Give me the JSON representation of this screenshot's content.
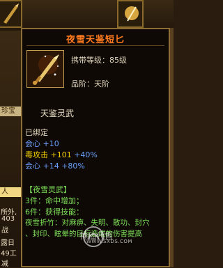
{
  "background": {
    "tab_label": "珍宝",
    "person_label": "人",
    "left_fragments": [
      "所外,",
      "403",
      "战",
      "露日",
      "49工",
      "减"
    ]
  },
  "tooltip": {
    "title": "夜雪天鉴短匕",
    "level_label": "携带等级：",
    "level_value": "85级",
    "grade_label": "品阶：",
    "grade_value": "天阶",
    "sub_title": "天鉴灵武",
    "bound": "已绑定",
    "stats": [
      {
        "name": "会心",
        "base": "+10",
        "bonus": "",
        "name_color": "blue"
      },
      {
        "name": "毒攻击",
        "base": "+101",
        "bonus": "+40%",
        "name_color": "yellow"
      },
      {
        "name": "会心",
        "base": "+14",
        "bonus": "+80%",
        "name_color": "blue"
      }
    ],
    "set_name": "【夜雪灵武】",
    "set_lines": [
      "3件：命中增加；",
      "6件：获得技能：",
      "夜雪折竹：对麻痹、失明、散功、封穴",
      "、封印、眩晕的目标造成的伤害提高"
    ]
  },
  "watermark": {
    "text": "神仙代售",
    "url": "WWW.SXDS.COM"
  }
}
